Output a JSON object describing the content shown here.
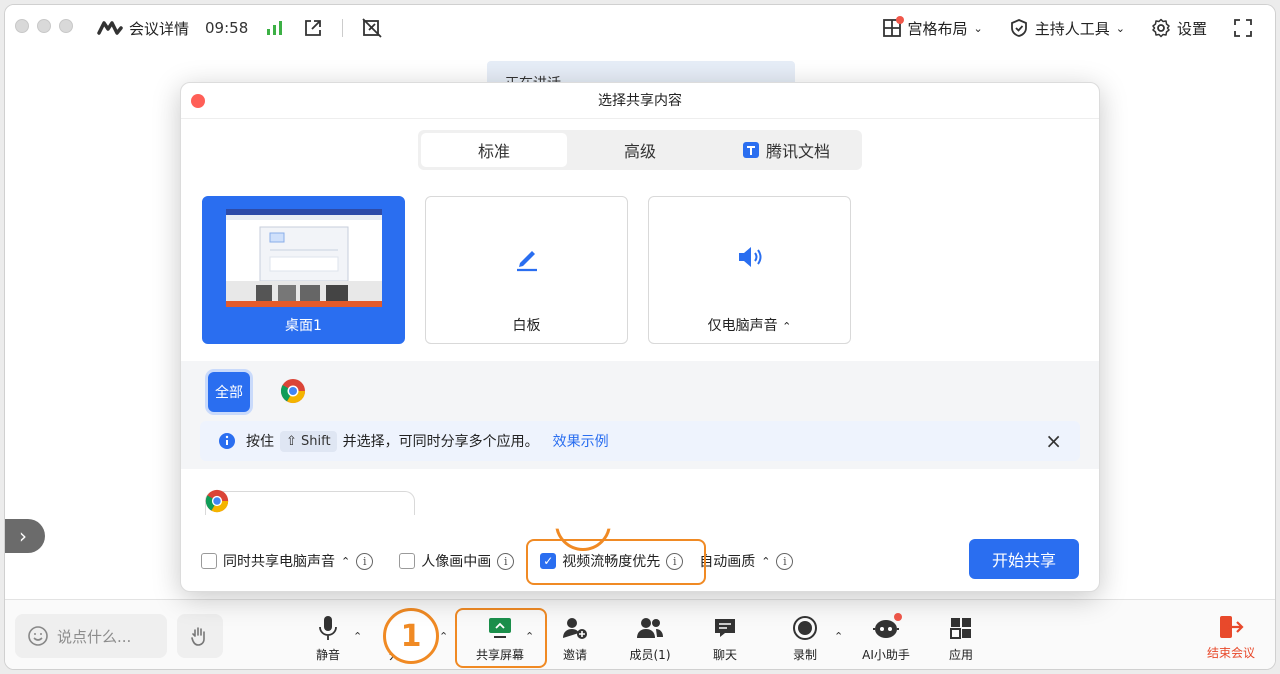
{
  "titlebar": {
    "app_name": "会议详情",
    "time": "09:58",
    "layout_label": "宫格布局",
    "host_tools_label": "主持人工具",
    "settings_label": "设置"
  },
  "stage": {
    "speaker_text": "正在讲话"
  },
  "dialog": {
    "title": "选择共享内容",
    "tabs": [
      {
        "label": "标准"
      },
      {
        "label": "高级"
      },
      {
        "label": "腾讯文档"
      }
    ],
    "cards": [
      {
        "label": "桌面1"
      },
      {
        "label": "白板"
      },
      {
        "label": "仅电脑声音"
      }
    ],
    "filter_all": "全部",
    "notice": {
      "prefix": "按住",
      "key": "Shift",
      "text": "并选择，可同时分享多个应用。",
      "link": "效果示例"
    },
    "options": {
      "share_audio": "同时共享电脑声音",
      "portrait": "人像画中画",
      "video_priority": "视频流畅度优先",
      "auto_quality": "自动画质"
    },
    "start_button": "开始共享"
  },
  "toolbar": {
    "chat_placeholder": "说点什么...",
    "mute": "静音",
    "video": "开",
    "share": "共享屏幕",
    "invite": "邀请",
    "members": "成员(1)",
    "chat": "聊天",
    "record": "录制",
    "ai": "AI小助手",
    "apps": "应用",
    "end": "结束会议"
  },
  "annotation": {
    "step": "1"
  },
  "colors": {
    "accent": "#2a6ef0",
    "highlight": "#f08a24",
    "danger": "#e8492b"
  }
}
